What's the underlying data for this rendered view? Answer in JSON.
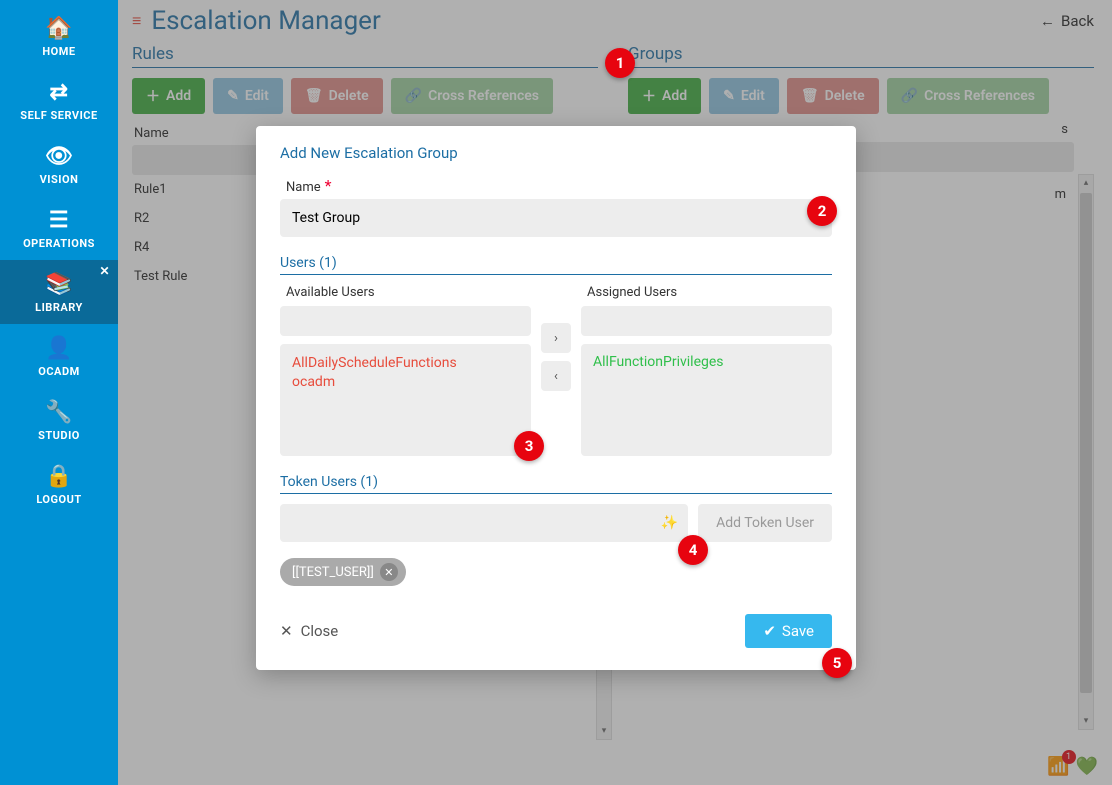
{
  "nav": {
    "items": [
      {
        "icon": "🏠",
        "label": "HOME"
      },
      {
        "icon": "⇄",
        "label": "SELF SERVICE"
      },
      {
        "icon": "👁",
        "label": "VISION"
      },
      {
        "icon": "☰",
        "label": "OPERATIONS"
      },
      {
        "icon": "📚",
        "label": "LIBRARY"
      },
      {
        "icon": "👤",
        "label": "OCADM"
      },
      {
        "icon": "🔧",
        "label": "STUDIO"
      },
      {
        "icon": "🔒",
        "label": "LOGOUT"
      }
    ]
  },
  "header": {
    "title": "Escalation Manager",
    "back": "Back"
  },
  "rules": {
    "title": "Rules",
    "toolbar": {
      "add": "Add",
      "edit": "Edit",
      "delete": "Delete",
      "cross": "Cross References"
    },
    "nameCol": "Name",
    "items": [
      "Rule1",
      "R2",
      "R4",
      "Test Rule"
    ]
  },
  "groups": {
    "title": "Groups",
    "toolbar": {
      "add": "Add",
      "edit": "Edit",
      "delete": "Delete",
      "cross": "Cross References"
    },
    "partialCell": "m"
  },
  "modal": {
    "title": "Add New Escalation Group",
    "nameLabel": "Name",
    "nameValue": "Test Group",
    "usersHead": "Users (1)",
    "availLabel": "Available Users",
    "assignedLabel": "Assigned Users",
    "availableUsers": [
      "AllDailyScheduleFunctions",
      "ocadm"
    ],
    "assignedUsers": [
      "AllFunctionPrivileges"
    ],
    "tokenHead": "Token Users (1)",
    "addTokenBtn": "Add Token User",
    "chipText": "[[TEST_USER]]",
    "close": "Close",
    "save": "Save"
  },
  "badges": {
    "b1": "1",
    "b2": "2",
    "b3": "3",
    "b4": "4",
    "b5": "5"
  },
  "footer": {
    "rssCount": "1"
  }
}
